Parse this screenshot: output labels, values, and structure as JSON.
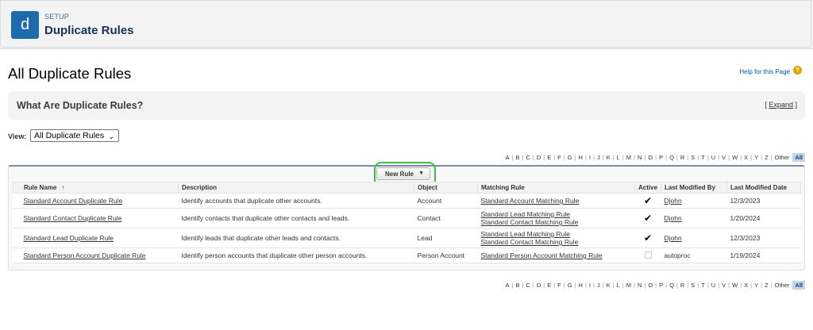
{
  "header": {
    "eyebrow": "SETUP",
    "title": "Duplicate Rules",
    "icon_letter": "d"
  },
  "page": {
    "title": "All Duplicate Rules",
    "help_label": "Help for this Page",
    "help_icon": "?"
  },
  "info_panel": {
    "title": "What Are Duplicate Rules?",
    "expand_open": "[",
    "expand_label": "Expand",
    "expand_close": "]"
  },
  "view": {
    "label": "View:",
    "selected": "All Duplicate Rules"
  },
  "alpha": [
    "A",
    "B",
    "C",
    "D",
    "E",
    "F",
    "G",
    "H",
    "I",
    "J",
    "K",
    "L",
    "M",
    "N",
    "O",
    "P",
    "Q",
    "R",
    "S",
    "T",
    "U",
    "V",
    "W",
    "X",
    "Y",
    "Z",
    "Other",
    "All"
  ],
  "new_rule": {
    "label": "New Rule"
  },
  "table": {
    "headers": {
      "name": "Rule Name",
      "sort_icon": "↑",
      "description": "Description",
      "object": "Object",
      "matching": "Matching Rule",
      "active": "Active",
      "modified_by": "Last Modified By",
      "modified_date": "Last Modified Date"
    },
    "rows": [
      {
        "name": "Standard Account Duplicate Rule",
        "description": "Identify accounts that duplicate other accounts.",
        "object": "Account",
        "matching": [
          "Standard Account Matching Rule"
        ],
        "active": true,
        "modified_by": "Djohn",
        "modified_date": "12/3/2023"
      },
      {
        "name": "Standard Contact Duplicate Rule",
        "description": "Identify contacts that duplicate other contacts and leads.",
        "object": "Contact",
        "matching": [
          "Standard Lead Matching Rule",
          "Standard Contact Matching Rule"
        ],
        "active": true,
        "modified_by": "Djohn",
        "modified_date": "1/20/2024"
      },
      {
        "name": "Standard Lead Duplicate Rule",
        "description": "Identify leads that duplicate other leads and contacts.",
        "object": "Lead",
        "matching": [
          "Standard Lead Matching Rule",
          "Standard Contact Matching Rule"
        ],
        "active": true,
        "modified_by": "Djohn",
        "modified_date": "12/3/2023"
      },
      {
        "name": "Standard Person Account Duplicate Rule",
        "description": "Identify person accounts that duplicate other person accounts.",
        "object": "Person Account",
        "matching": [
          "Standard Person Account Matching Rule"
        ],
        "active": false,
        "modified_by": "autoproc",
        "modified_date": "1/19/2024"
      }
    ]
  },
  "colors": {
    "brand_icon": "#1b6bad",
    "highlight": "#39c33a",
    "link": "#015ba7"
  }
}
